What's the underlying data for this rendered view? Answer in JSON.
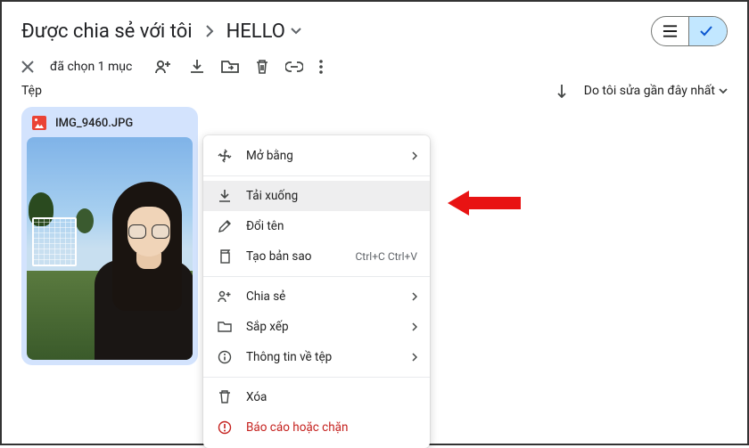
{
  "breadcrumb": {
    "shared": "Được chia sẻ với tôi",
    "current": "HELLO"
  },
  "toolbar": {
    "selection_text": "đã chọn 1 mục"
  },
  "section": {
    "label": "Tệp",
    "sort_label": "Do tôi sửa gần đây nhất"
  },
  "file": {
    "name": "IMG_9460.JPG"
  },
  "menu": {
    "open_with": "Mở bằng",
    "download": "Tải xuống",
    "rename": "Đổi tên",
    "make_copy": "Tạo bản sao",
    "make_copy_shortcut": "Ctrl+C Ctrl+V",
    "share": "Chia sẻ",
    "organize": "Sắp xếp",
    "file_info": "Thông tin về tệp",
    "remove": "Xóa",
    "report": "Báo cáo hoặc chặn"
  }
}
